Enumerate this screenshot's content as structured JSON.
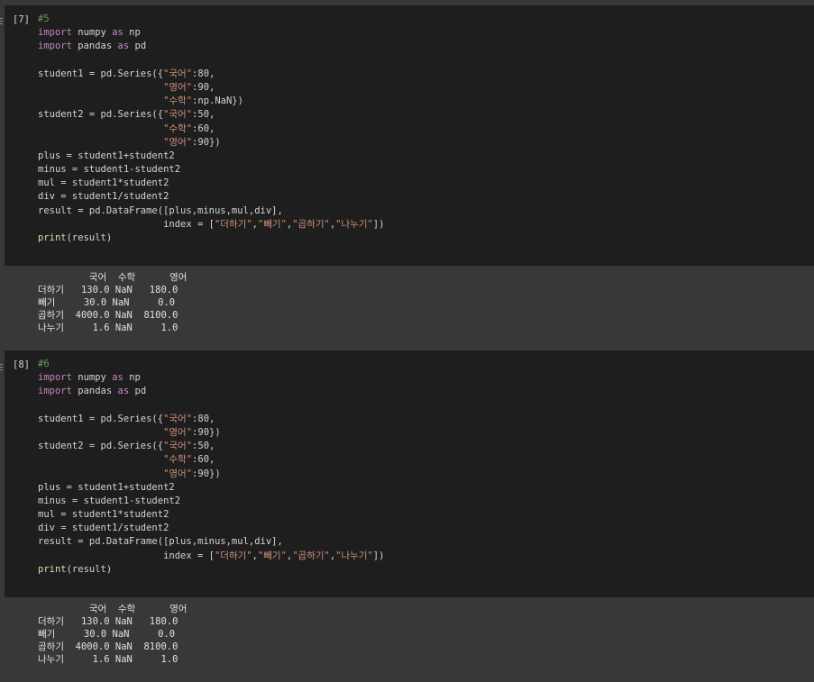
{
  "cells": [
    {
      "exec_count": "[7]",
      "code_lines": [
        [
          {
            "t": "#5",
            "c": "cm"
          }
        ],
        [
          {
            "t": "import",
            "c": "kw"
          },
          {
            "t": " numpy ",
            "c": "id"
          },
          {
            "t": "as",
            "c": "kw"
          },
          {
            "t": " np",
            "c": "id"
          }
        ],
        [
          {
            "t": "import",
            "c": "kw"
          },
          {
            "t": " pandas ",
            "c": "id"
          },
          {
            "t": "as",
            "c": "kw"
          },
          {
            "t": " pd",
            "c": "id"
          }
        ],
        [
          {
            "t": "",
            "c": "id"
          }
        ],
        [
          {
            "t": "student1 = pd.Series({",
            "c": "id"
          },
          {
            "t": "\"국어\"",
            "c": "str"
          },
          {
            "t": ":80,",
            "c": "id"
          }
        ],
        [
          {
            "t": "                      ",
            "c": "id"
          },
          {
            "t": "\"영어\"",
            "c": "str"
          },
          {
            "t": ":90,",
            "c": "id"
          }
        ],
        [
          {
            "t": "                      ",
            "c": "id"
          },
          {
            "t": "\"수학\"",
            "c": "str"
          },
          {
            "t": ":np.NaN})",
            "c": "id"
          }
        ],
        [
          {
            "t": "student2 = pd.Series({",
            "c": "id"
          },
          {
            "t": "\"국어\"",
            "c": "str"
          },
          {
            "t": ":50,",
            "c": "id"
          }
        ],
        [
          {
            "t": "                      ",
            "c": "id"
          },
          {
            "t": "\"수학\"",
            "c": "str"
          },
          {
            "t": ":60,",
            "c": "id"
          }
        ],
        [
          {
            "t": "                      ",
            "c": "id"
          },
          {
            "t": "\"영어\"",
            "c": "str"
          },
          {
            "t": ":90})",
            "c": "id"
          }
        ],
        [
          {
            "t": "plus = student1+student2",
            "c": "id"
          }
        ],
        [
          {
            "t": "minus = student1-student2",
            "c": "id"
          }
        ],
        [
          {
            "t": "mul = student1*student2",
            "c": "id"
          }
        ],
        [
          {
            "t": "div = student1/student2",
            "c": "id"
          }
        ],
        [
          {
            "t": "result = pd.DataFrame([plus,minus,mul,div],",
            "c": "id"
          }
        ],
        [
          {
            "t": "                      index = [",
            "c": "id"
          },
          {
            "t": "\"더하기\"",
            "c": "str"
          },
          {
            "t": ",",
            "c": "id"
          },
          {
            "t": "\"빼기\"",
            "c": "str"
          },
          {
            "t": ",",
            "c": "id"
          },
          {
            "t": "\"곱하기\"",
            "c": "str"
          },
          {
            "t": ",",
            "c": "id"
          },
          {
            "t": "\"나누기\"",
            "c": "str"
          },
          {
            "t": "])",
            "c": "id"
          }
        ],
        [
          {
            "t": "print",
            "c": "fn"
          },
          {
            "t": "(result)",
            "c": "id"
          }
        ]
      ],
      "output_lines": [
        "         국어  수학      영어",
        "더하기   130.0 NaN   180.0",
        "빼기     30.0 NaN     0.0",
        "곱하기  4000.0 NaN  8100.0",
        "나누기     1.6 NaN     1.0"
      ]
    },
    {
      "exec_count": "[8]",
      "code_lines": [
        [
          {
            "t": "#6",
            "c": "cm"
          }
        ],
        [
          {
            "t": "import",
            "c": "kw"
          },
          {
            "t": " numpy ",
            "c": "id"
          },
          {
            "t": "as",
            "c": "kw"
          },
          {
            "t": " np",
            "c": "id"
          }
        ],
        [
          {
            "t": "import",
            "c": "kw"
          },
          {
            "t": " pandas ",
            "c": "id"
          },
          {
            "t": "as",
            "c": "kw"
          },
          {
            "t": " pd",
            "c": "id"
          }
        ],
        [
          {
            "t": "",
            "c": "id"
          }
        ],
        [
          {
            "t": "student1 = pd.Series({",
            "c": "id"
          },
          {
            "t": "\"국어\"",
            "c": "str"
          },
          {
            "t": ":80,",
            "c": "id"
          }
        ],
        [
          {
            "t": "                      ",
            "c": "id"
          },
          {
            "t": "\"영어\"",
            "c": "str"
          },
          {
            "t": ":90})",
            "c": "id"
          }
        ],
        [
          {
            "t": "student2 = pd.Series({",
            "c": "id"
          },
          {
            "t": "\"국어\"",
            "c": "str"
          },
          {
            "t": ":50,",
            "c": "id"
          }
        ],
        [
          {
            "t": "                      ",
            "c": "id"
          },
          {
            "t": "\"수학\"",
            "c": "str"
          },
          {
            "t": ":60,",
            "c": "id"
          }
        ],
        [
          {
            "t": "                      ",
            "c": "id"
          },
          {
            "t": "\"영어\"",
            "c": "str"
          },
          {
            "t": ":90})",
            "c": "id"
          }
        ],
        [
          {
            "t": "plus = student1+student2",
            "c": "id"
          }
        ],
        [
          {
            "t": "minus = student1-student2",
            "c": "id"
          }
        ],
        [
          {
            "t": "mul = student1*student2",
            "c": "id"
          }
        ],
        [
          {
            "t": "div = student1/student2",
            "c": "id"
          }
        ],
        [
          {
            "t": "result = pd.DataFrame([plus,minus,mul,div],",
            "c": "id"
          }
        ],
        [
          {
            "t": "                      index = [",
            "c": "id"
          },
          {
            "t": "\"더하기\"",
            "c": "str"
          },
          {
            "t": ",",
            "c": "id"
          },
          {
            "t": "\"빼기\"",
            "c": "str"
          },
          {
            "t": ",",
            "c": "id"
          },
          {
            "t": "\"곱하기\"",
            "c": "str"
          },
          {
            "t": ",",
            "c": "id"
          },
          {
            "t": "\"나누기\"",
            "c": "str"
          },
          {
            "t": "])",
            "c": "id"
          }
        ],
        [
          {
            "t": "print",
            "c": "fn"
          },
          {
            "t": "(result)",
            "c": "id"
          }
        ]
      ],
      "output_lines": [
        "         국어  수학      영어",
        "더하기   130.0 NaN   180.0",
        "빼기     30.0 NaN     0.0",
        "곱하기  4000.0 NaN  8100.0",
        "나누기     1.6 NaN     1.0"
      ]
    }
  ],
  "colors": {
    "code_bg": "#1e1e1e",
    "page_bg": "#383838",
    "keyword": "#c586c0",
    "comment": "#6a9955",
    "string": "#ce9178",
    "function": "#dcdcaa"
  }
}
